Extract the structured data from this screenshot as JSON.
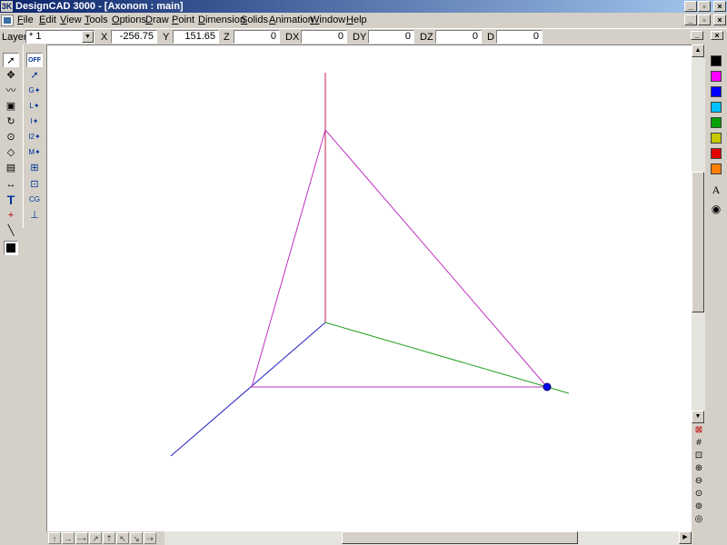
{
  "window": {
    "app_icon": "3K",
    "title": "DesignCAD 3000 - [Axonom : main]",
    "minimize": "_",
    "maximize": "▫",
    "close": "×"
  },
  "menu": {
    "items": [
      "File",
      "Edit",
      "View",
      "Tools",
      "Options",
      "Draw",
      "Point",
      "Dimension",
      "Solids",
      "Animation",
      "Window",
      "Help"
    ]
  },
  "coords": {
    "layer_label": "Layer",
    "layer_value": "* 1",
    "x_label": "X",
    "x_value": "-256.75",
    "y_label": "Y",
    "y_value": "151.65",
    "z_label": "Z",
    "z_value": "0",
    "dx_label": "DX",
    "dx_value": "0",
    "dy_label": "DY",
    "dy_value": "0",
    "dz_label": "DZ",
    "dz_value": "0",
    "d_label": "D",
    "d_value": "0"
  },
  "toolbox_left": {
    "tools": [
      "select-arrow-icon",
      "move-icon",
      "polyline-icon",
      "solid-box-icon",
      "rotate-icon",
      "circle-icon",
      "polygon-icon",
      "image-icon",
      "dimension-icon",
      "text-icon",
      "cursor-point-icon",
      "line-icon",
      "fill-color-icon"
    ],
    "text_tool": "T"
  },
  "snap_toolbox": {
    "off_label": "OFF",
    "tools": [
      "snap-select-icon",
      "gravity-snap-icon",
      "line-snap-icon",
      "intersection-snap-icon",
      "two-line-snap-icon",
      "midpoint-snap-icon",
      "center-snap-icon",
      "grid-snap-icon",
      "cg-snap-icon",
      "perpendicular-snap-icon"
    ]
  },
  "palette": {
    "colors": [
      "#000000",
      "#ff00ff",
      "#0000ff",
      "#00c0ff",
      "#00a000",
      "#c8c800",
      "#e00000",
      "#ff8000"
    ],
    "text_icon": "A",
    "eye_icon": "eye-icon"
  },
  "view_tools": [
    "view-close-icon",
    "grid-icon",
    "zoom-window-icon",
    "zoom-in-icon",
    "zoom-out-icon",
    "zoom-extents-icon",
    "zoom-previous-icon",
    "zoom-all-icon"
  ],
  "drawing": {
    "accent_point_color": "#0000ff"
  }
}
